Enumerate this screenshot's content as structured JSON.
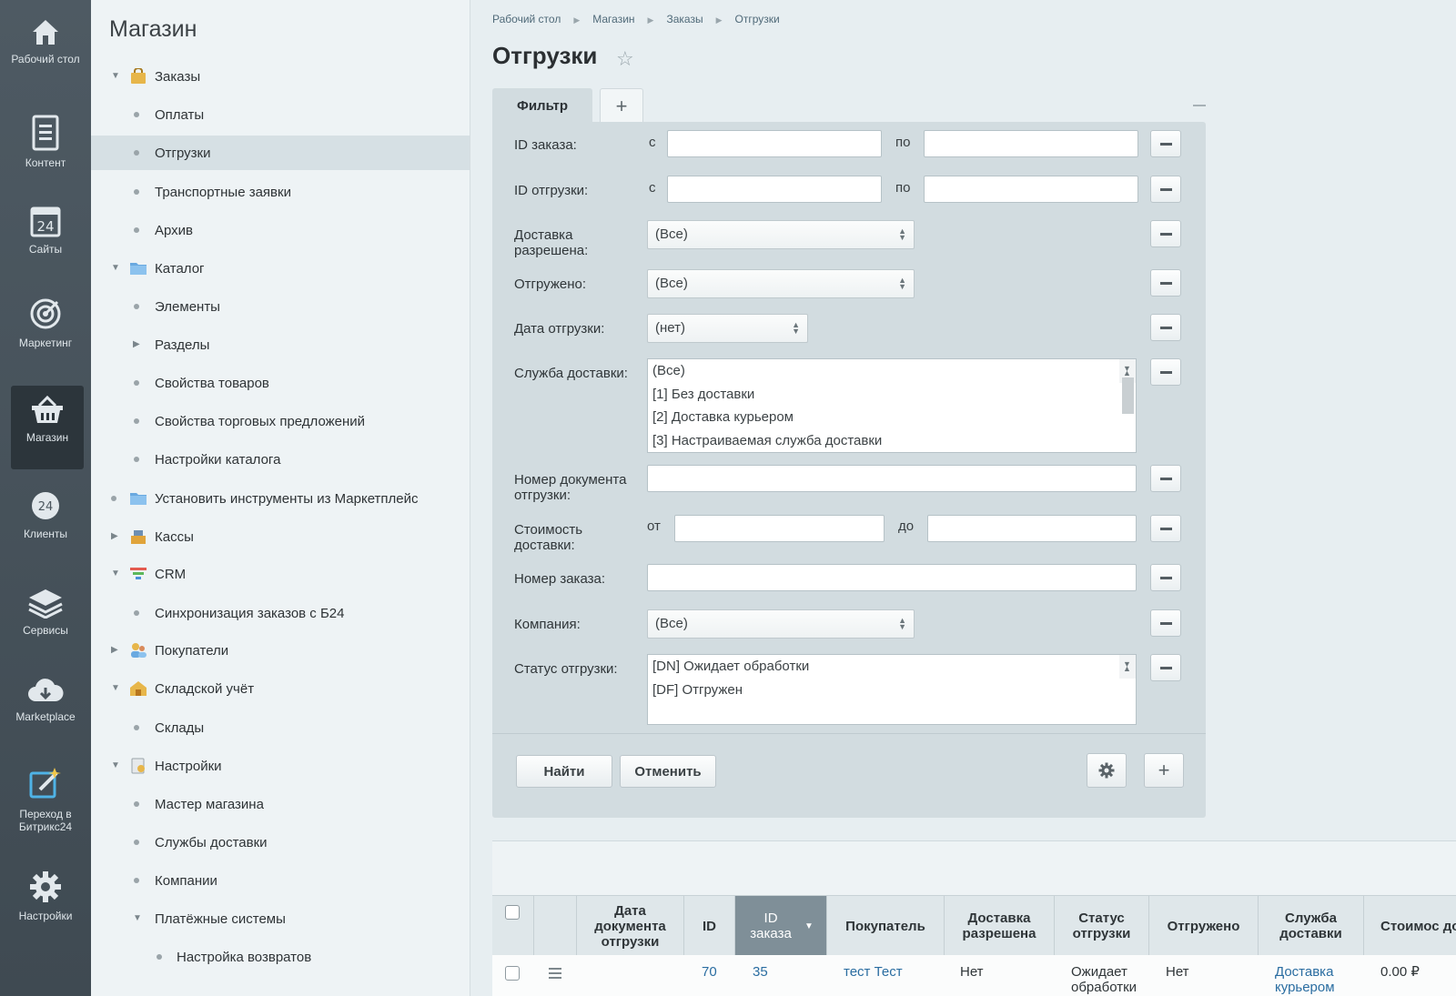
{
  "rail": [
    {
      "label": "Рабочий стол",
      "icon": "home-icon"
    },
    {
      "label": "Контент",
      "icon": "document-icon"
    },
    {
      "label": "Сайты",
      "icon": "calendar-24-icon"
    },
    {
      "label": "Маркетинг",
      "icon": "target-icon"
    },
    {
      "label": "Магазин",
      "icon": "basket-icon"
    },
    {
      "label": "Клиенты",
      "icon": "clients-24-icon"
    },
    {
      "label": "Сервисы",
      "icon": "layers-icon"
    },
    {
      "label": "Marketplace",
      "icon": "cloud-download-icon"
    },
    {
      "label": "Переход в Битрикс24",
      "icon": "external-edit-icon"
    },
    {
      "label": "Настройки",
      "icon": "gear-icon"
    }
  ],
  "menu": {
    "title": "Магазин",
    "items": [
      {
        "label": "Заказы"
      },
      {
        "label": "Оплаты"
      },
      {
        "label": "Отгрузки"
      },
      {
        "label": "Транспортные заявки"
      },
      {
        "label": "Архив"
      },
      {
        "label": "Каталог"
      },
      {
        "label": "Элементы"
      },
      {
        "label": "Разделы"
      },
      {
        "label": "Свойства товаров"
      },
      {
        "label": "Свойства торговых предложений"
      },
      {
        "label": "Настройки каталога"
      },
      {
        "label": "Установить инструменты из Маркетплейс"
      },
      {
        "label": "Кассы"
      },
      {
        "label": "CRM"
      },
      {
        "label": "Синхронизация заказов с Б24"
      },
      {
        "label": "Покупатели"
      },
      {
        "label": "Складской учёт"
      },
      {
        "label": "Склады"
      },
      {
        "label": "Настройки"
      },
      {
        "label": "Мастер магазина"
      },
      {
        "label": "Службы доставки"
      },
      {
        "label": "Компании"
      },
      {
        "label": "Платёжные системы"
      },
      {
        "label": "Настройка возвратов"
      }
    ]
  },
  "breadcrumbs": [
    "Рабочий стол",
    "Магазин",
    "Заказы",
    "Отгрузки"
  ],
  "page_title": "Отгрузки",
  "filter": {
    "tab_label": "Фильтр",
    "add_tab": "+",
    "order_id": {
      "label": "ID заказа:",
      "from": "с",
      "to": "по",
      "from_value": "",
      "to_value": ""
    },
    "shipment_id": {
      "label": "ID отгрузки:",
      "from": "с",
      "to": "по",
      "from_value": "",
      "to_value": ""
    },
    "delivery_allowed": {
      "label": "Доставка разрешена:",
      "value": "(Все)"
    },
    "shipped": {
      "label": "Отгружено:",
      "value": "(Все)"
    },
    "shipment_date": {
      "label": "Дата отгрузки:",
      "value": "(нет)"
    },
    "delivery_service": {
      "label": "Служба доставки:",
      "options": [
        "(Все)",
        "[1] Без доставки",
        "[2] Доставка курьером",
        "[3] Настраиваемая служба доставки"
      ]
    },
    "doc_number": {
      "label": "Номер документа отгрузки:",
      "value": ""
    },
    "delivery_cost": {
      "label": "Стоимость доставки:",
      "from": "от",
      "to": "до",
      "from_value": "",
      "to_value": ""
    },
    "order_number": {
      "label": "Номер заказа:",
      "value": ""
    },
    "company": {
      "label": "Компания:",
      "value": "(Все)"
    },
    "shipment_status": {
      "label": "Статус отгрузки:",
      "options": [
        "[DN] Ожидает обработки",
        "[DF] Отгружен"
      ]
    },
    "find_button": "Найти",
    "cancel_button": "Отменить"
  },
  "grid": {
    "columns": [
      "Дата документа отгрузки",
      "ID",
      "ID заказа",
      "Покупатель",
      "Доставка разрешена",
      "Статус отгрузки",
      "Отгружено",
      "Служба доставки",
      "Стоимос доставк"
    ],
    "row": {
      "id": "70",
      "order_id": "35",
      "buyer": "тест Тест",
      "delivery_allowed": "Нет",
      "status": "Ожидает обработки",
      "shipped": "Нет",
      "service": "Доставка курьером",
      "cost": "0.00 ₽"
    }
  }
}
